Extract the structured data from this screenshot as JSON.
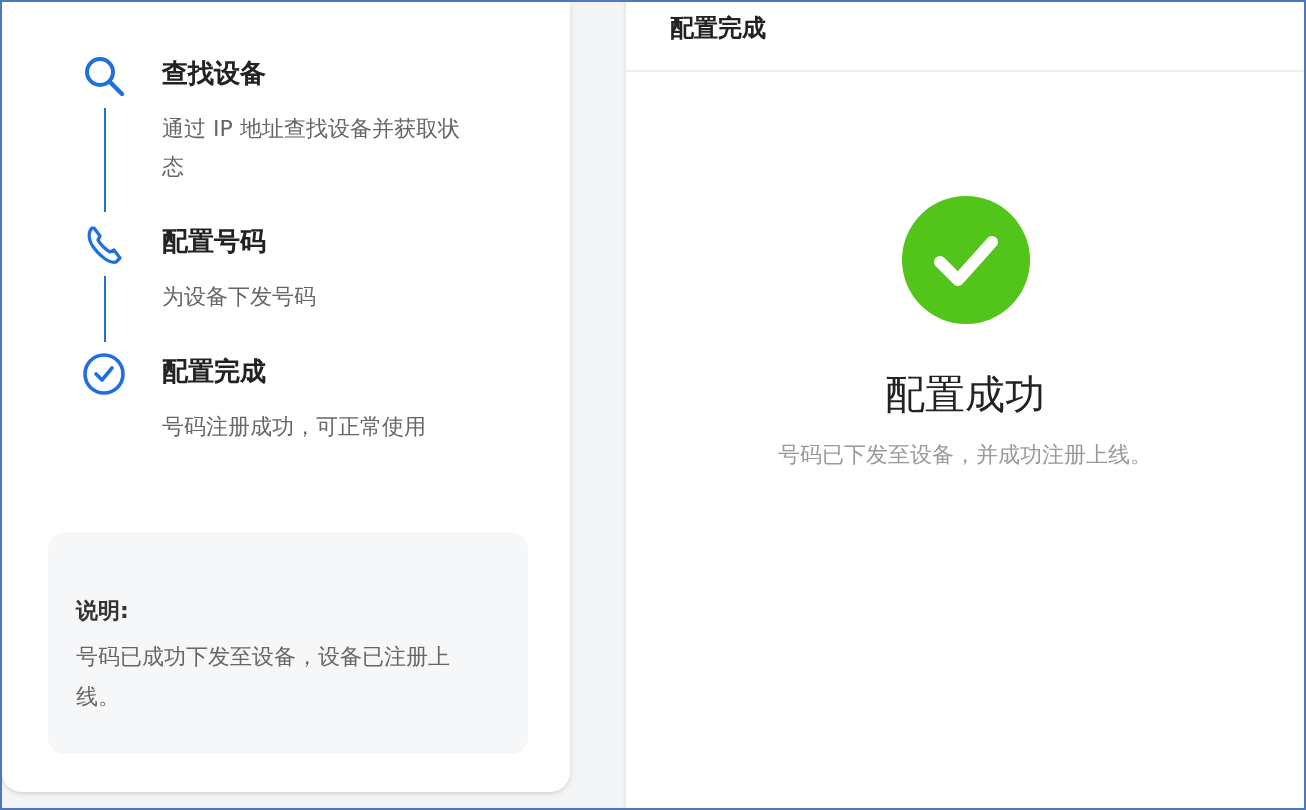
{
  "steps": [
    {
      "kind": "search",
      "title": "查找设备",
      "description": "通过 IP 地址查找设备并获取状态"
    },
    {
      "kind": "phone",
      "title": "配置号码",
      "description": "为设备下发号码"
    },
    {
      "kind": "check",
      "title": "配置完成",
      "description": "号码注册成功，可正常使用"
    }
  ],
  "note": {
    "title": "说明:",
    "text": "号码已成功下发至设备，设备已注册上线。"
  },
  "result_panel": {
    "header": "配置完成",
    "title": "配置成功",
    "message": "号码已下发至设备，并成功注册上线。"
  }
}
